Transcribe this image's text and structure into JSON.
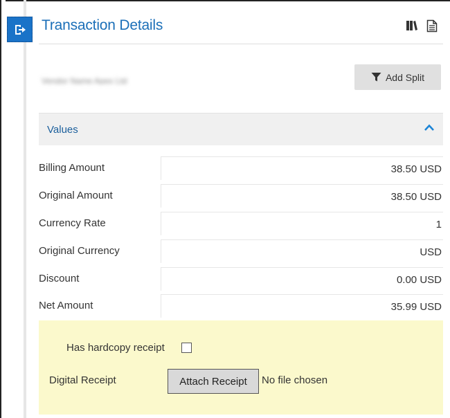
{
  "header": {
    "title": "Transaction Details",
    "exit_icon": "exit-panel-icon",
    "icons": [
      "books-icon",
      "document-icon"
    ]
  },
  "toolbar": {
    "blurred_text": "Vendor Name Apex Ltd",
    "add_split_label": "Add Split",
    "add_split_icon": "filter-icon"
  },
  "values_section": {
    "title": "Values",
    "collapse_icon": "chevron-up-icon",
    "rows": [
      {
        "label": "Billing Amount",
        "value": "38.50 USD"
      },
      {
        "label": "Original Amount",
        "value": "38.50 USD"
      },
      {
        "label": "Currency Rate",
        "value": "1"
      },
      {
        "label": "Original Currency",
        "value": "USD"
      },
      {
        "label": "Discount",
        "value": "0.00 USD"
      },
      {
        "label": "Net Amount",
        "value": "35.99 USD"
      }
    ]
  },
  "receipt": {
    "hardcopy_label": "Has hardcopy receipt",
    "hardcopy_checked": false,
    "digital_label": "Digital Receipt",
    "attach_label": "Attach Receipt",
    "file_status": "No file chosen"
  },
  "colors": {
    "accent": "#1b6fb8",
    "exit_button": "#1a73c8",
    "section_bg": "#f0f0f0",
    "receipt_bg": "#fbf9cc",
    "button_bg": "#e0e0e0"
  }
}
